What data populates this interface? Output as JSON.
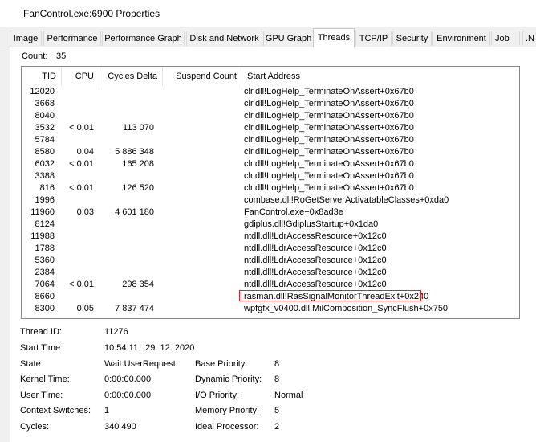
{
  "window": {
    "title": "FanControl.exe:6900 Properties"
  },
  "tabs": [
    {
      "label": "Image"
    },
    {
      "label": "Performance"
    },
    {
      "label": "Performance Graph"
    },
    {
      "label": "Disk and Network"
    },
    {
      "label": "GPU Graph"
    },
    {
      "label": "Threads"
    },
    {
      "label": "TCP/IP"
    },
    {
      "label": "Security"
    },
    {
      "label": "Environment"
    },
    {
      "label": "Job"
    },
    {
      "label": ".N"
    }
  ],
  "active_tab": "Threads",
  "threads": {
    "count_label": "Count:",
    "count_value": "35",
    "columns": {
      "tid": "TID",
      "cpu": "CPU",
      "cycles": "Cycles Delta",
      "suspend": "Suspend Count",
      "address": "Start Address"
    },
    "rows": [
      {
        "tid": "12020",
        "cpu": "",
        "cycles": "",
        "suspend": "",
        "address": "clr.dll!LogHelp_TerminateOnAssert+0x67b0"
      },
      {
        "tid": "3668",
        "cpu": "",
        "cycles": "",
        "suspend": "",
        "address": "clr.dll!LogHelp_TerminateOnAssert+0x67b0"
      },
      {
        "tid": "8040",
        "cpu": "",
        "cycles": "",
        "suspend": "",
        "address": "clr.dll!LogHelp_TerminateOnAssert+0x67b0"
      },
      {
        "tid": "3532",
        "cpu": "< 0.01",
        "cycles": "113 070",
        "suspend": "",
        "address": "clr.dll!LogHelp_TerminateOnAssert+0x67b0"
      },
      {
        "tid": "5784",
        "cpu": "",
        "cycles": "",
        "suspend": "",
        "address": "clr.dll!LogHelp_TerminateOnAssert+0x67b0"
      },
      {
        "tid": "8580",
        "cpu": "0.04",
        "cycles": "5 886 348",
        "suspend": "",
        "address": "clr.dll!LogHelp_TerminateOnAssert+0x67b0"
      },
      {
        "tid": "6032",
        "cpu": "< 0.01",
        "cycles": "165 208",
        "suspend": "",
        "address": "clr.dll!LogHelp_TerminateOnAssert+0x67b0"
      },
      {
        "tid": "3388",
        "cpu": "",
        "cycles": "",
        "suspend": "",
        "address": "clr.dll!LogHelp_TerminateOnAssert+0x67b0"
      },
      {
        "tid": "816",
        "cpu": "< 0.01",
        "cycles": "126 520",
        "suspend": "",
        "address": "clr.dll!LogHelp_TerminateOnAssert+0x67b0"
      },
      {
        "tid": "1996",
        "cpu": "",
        "cycles": "",
        "suspend": "",
        "address": "combase.dll!RoGetServerActivatableClasses+0xda0"
      },
      {
        "tid": "11960",
        "cpu": "0.03",
        "cycles": "4 601 180",
        "suspend": "",
        "address": "FanControl.exe+0x8ad3e"
      },
      {
        "tid": "8124",
        "cpu": "",
        "cycles": "",
        "suspend": "",
        "address": "gdiplus.dll!GdiplusStartup+0x1da0"
      },
      {
        "tid": "11988",
        "cpu": "",
        "cycles": "",
        "suspend": "",
        "address": "ntdll.dll!LdrAccessResource+0x12c0"
      },
      {
        "tid": "1788",
        "cpu": "",
        "cycles": "",
        "suspend": "",
        "address": "ntdll.dll!LdrAccessResource+0x12c0"
      },
      {
        "tid": "5360",
        "cpu": "",
        "cycles": "",
        "suspend": "",
        "address": "ntdll.dll!LdrAccessResource+0x12c0"
      },
      {
        "tid": "2384",
        "cpu": "",
        "cycles": "",
        "suspend": "",
        "address": "ntdll.dll!LdrAccessResource+0x12c0"
      },
      {
        "tid": "7064",
        "cpu": "< 0.01",
        "cycles": "298 354",
        "suspend": "",
        "address": "ntdll.dll!LdrAccessResource+0x12c0"
      },
      {
        "tid": "8660",
        "cpu": "",
        "cycles": "",
        "suspend": "",
        "address": "rasman.dll!RasSignalMonitorThreadExit+0x240"
      },
      {
        "tid": "8300",
        "cpu": "0.05",
        "cycles": "7 837 474",
        "suspend": "",
        "address": "wpfgfx_v0400.dll!MilComposition_SyncFlush+0x750"
      }
    ]
  },
  "details": {
    "thread_id_label": "Thread ID:",
    "thread_id_value": "11276",
    "start_time_label": "Start Time:",
    "start_time_value": "10:54:11   29. 12. 2020",
    "state_label": "State:",
    "state_value": "Wait:UserRequest",
    "base_priority_label": "Base Priority:",
    "base_priority_value": "8",
    "kernel_time_label": "Kernel Time:",
    "kernel_time_value": "0:00:00.000",
    "dynamic_priority_label": "Dynamic Priority:",
    "dynamic_priority_value": "8",
    "user_time_label": "User Time:",
    "user_time_value": "0:00:00.000",
    "io_priority_label": "I/O Priority:",
    "io_priority_value": "Normal",
    "context_switches_label": "Context Switches:",
    "context_switches_value": "1",
    "memory_priority_label": "Memory Priority:",
    "memory_priority_value": "5",
    "cycles_label": "Cycles:",
    "cycles_value": "340 490",
    "ideal_processor_label": "Ideal Processor:",
    "ideal_processor_value": "2"
  },
  "colors": {
    "highlight_border": "#e02020",
    "list_border": "#828790",
    "window_background": "#f0f0f0"
  }
}
